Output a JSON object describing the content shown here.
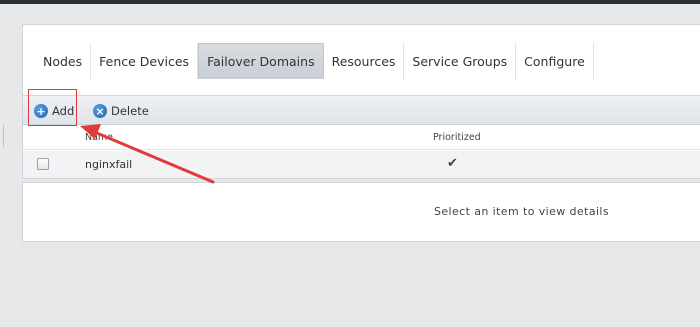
{
  "tabs": [
    {
      "label": "Nodes",
      "active": false
    },
    {
      "label": "Fence Devices",
      "active": false
    },
    {
      "label": "Failover Domains",
      "active": true
    },
    {
      "label": "Resources",
      "active": false
    },
    {
      "label": "Service Groups",
      "active": false
    },
    {
      "label": "Configure",
      "active": false
    }
  ],
  "toolbar": {
    "add_label": "Add",
    "delete_label": "Delete"
  },
  "table": {
    "columns": [
      "Name",
      "Prioritized"
    ],
    "rows": [
      {
        "name": "nginxfail",
        "prioritized": "✔",
        "checked": false
      }
    ]
  },
  "details": {
    "empty_message": "Select an item to view details"
  },
  "colors": {
    "annotation": "#e23a3a",
    "button_icon": "#1c62b0"
  }
}
